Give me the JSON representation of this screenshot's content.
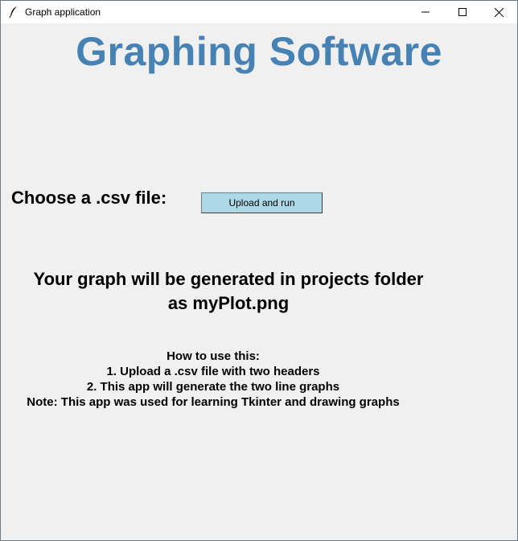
{
  "window": {
    "title": "Graph application"
  },
  "titlebar_icons": {
    "app": "feather-icon",
    "minimize": "minimize-icon",
    "maximize": "maximize-icon",
    "close": "close-icon"
  },
  "main": {
    "heading": "Graphing Software",
    "heading_color": "#4682b4",
    "choose_label": "Choose a .csv file:",
    "upload_button_label": "Upload and run",
    "upload_button_color": "#add8e6",
    "output_line_1": "Your graph will be generated in projects folder",
    "output_line_2": "as myPlot.png",
    "instructions": [
      "How to use this:",
      "1. Upload a .csv file with two headers",
      "2. This app will generate the two line graphs",
      "Note: This app was used for learning Tkinter and drawing graphs"
    ]
  }
}
